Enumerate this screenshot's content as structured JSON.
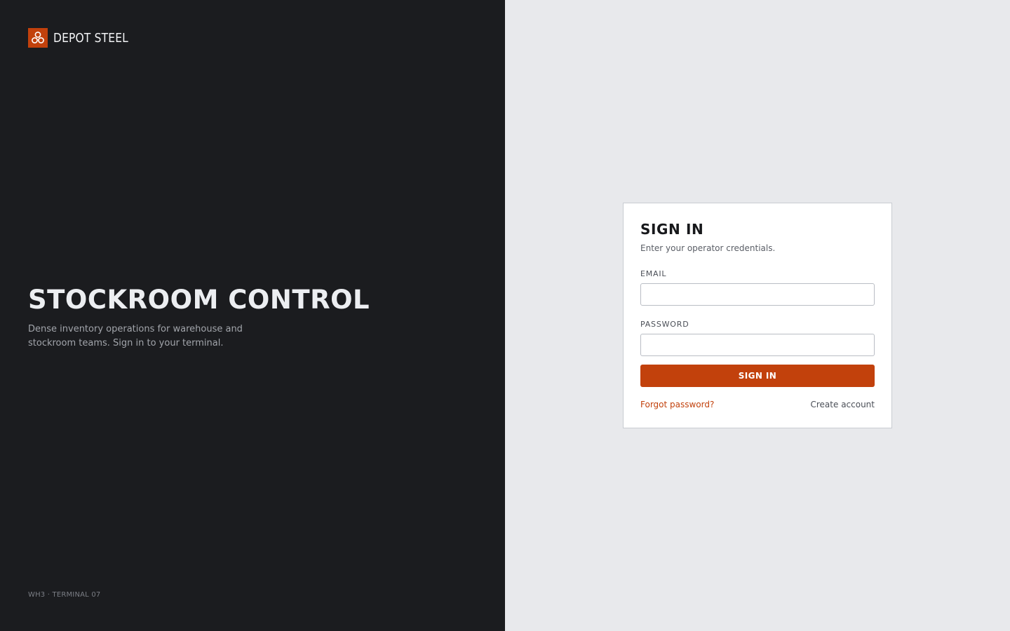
{
  "brand": {
    "name": "DEPOT STEEL",
    "logo_icon": "cubes-icon",
    "accent_color": "#c2410c"
  },
  "hero": {
    "title": "STOCKROOM CONTROL",
    "subtitle": "Dense inventory operations for warehouse and stockroom teams. Sign in to your terminal."
  },
  "footer": {
    "terminal_id": "WH3 · TERMINAL 07"
  },
  "signin": {
    "title": "SIGN IN",
    "subtitle": "Enter your operator credentials.",
    "email_label": "EMAIL",
    "email_value": "",
    "email_placeholder": "",
    "password_label": "PASSWORD",
    "password_value": "",
    "password_placeholder": "",
    "submit_label": "SIGN IN",
    "forgot_label": "Forgot password?",
    "create_label": "Create account"
  }
}
